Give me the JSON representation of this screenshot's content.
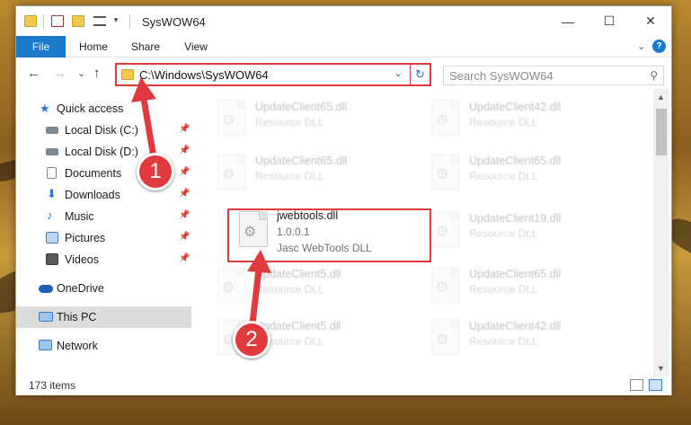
{
  "window": {
    "title": "SysWOW64",
    "minimize": "—",
    "maximize": "☐",
    "close": "✕"
  },
  "ribbon": {
    "tabs": [
      "File",
      "Home",
      "Share",
      "View"
    ],
    "expand": "⌄"
  },
  "navigation": {
    "back": "←",
    "forward": "→",
    "recent": "⌄",
    "up": "↑",
    "address_path": "C:\\Windows\\SysWOW64",
    "address_dropdown": "⌄",
    "refresh": "↻",
    "search_placeholder": "Search SysWOW64",
    "search_icon": "⚲"
  },
  "sidebar": {
    "items": [
      {
        "label": "Quick access",
        "icon": "star-icon",
        "pinned": false
      },
      {
        "label": "Local Disk (C:)",
        "icon": "drive-icon",
        "pinned": true
      },
      {
        "label": "Local Disk (D:)",
        "icon": "drive-icon",
        "pinned": true
      },
      {
        "label": "Documents",
        "icon": "documents-icon",
        "pinned": true
      },
      {
        "label": "Downloads",
        "icon": "download-icon",
        "pinned": true
      },
      {
        "label": "Music",
        "icon": "music-icon",
        "pinned": true
      },
      {
        "label": "Pictures",
        "icon": "pictures-icon",
        "pinned": true
      },
      {
        "label": "Videos",
        "icon": "videos-icon",
        "pinned": true
      },
      {
        "label": "OneDrive",
        "icon": "cloud-icon",
        "pinned": false
      },
      {
        "label": "This PC",
        "icon": "computer-icon",
        "pinned": false,
        "selected": true
      },
      {
        "label": "Network",
        "icon": "network-icon",
        "pinned": false
      }
    ],
    "pin_glyph": "📌"
  },
  "files": [
    {
      "name": "UpdateClient65.dll",
      "desc": "Resource DLL",
      "faded": true
    },
    {
      "name": "UpdateClient42.dll",
      "desc": "Resource DLL",
      "faded": true
    },
    {
      "name": "UpdateClient65.dll",
      "desc": "Resource DLL",
      "faded": true
    },
    {
      "name": "UpdateClient65.dll",
      "desc": "Resource DLL",
      "faded": true
    },
    {
      "name": "jwebtools.dll",
      "version": "1.0.0.1",
      "desc": "Jasc WebTools DLL",
      "faded": false,
      "highlighted": true
    },
    {
      "name": "UpdateClient19.dll",
      "desc": "Resource DLL",
      "faded": true
    },
    {
      "name": "UpdateClient5.dll",
      "desc": "Resource DLL",
      "faded": true
    },
    {
      "name": "UpdateClient65.dll",
      "desc": "Resource DLL",
      "faded": true
    },
    {
      "name": "UpdateClient5.dll",
      "desc": "Resource DLL",
      "faded": true
    },
    {
      "name": "UpdateClient42.dll",
      "desc": "Resource DLL",
      "faded": true
    }
  ],
  "statusbar": {
    "item_count": "173 items"
  },
  "annotations": {
    "step1": "1",
    "step2": "2",
    "color": "#e0393e"
  }
}
